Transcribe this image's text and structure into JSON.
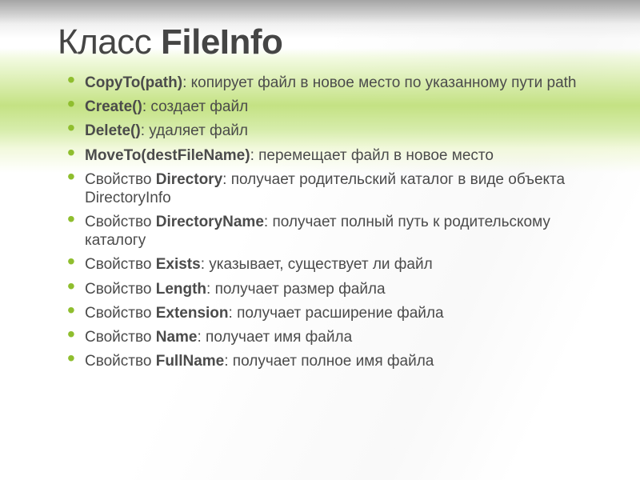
{
  "title": {
    "prefix": "Класс ",
    "name": "FileInfo"
  },
  "items": [
    {
      "method": "CopyTo(path)",
      "desc": ": копирует файл в новое место по указанному пути path"
    },
    {
      "method": "Create()",
      "desc": ": создает файл"
    },
    {
      "method": "Delete()",
      "desc": ": удаляет файл"
    },
    {
      "method": "MoveTo(destFileName)",
      "desc": ": перемещает файл в новое место"
    },
    {
      "prefix": "Свойство ",
      "method": "Directory",
      "desc": ": получает родительский каталог в виде объекта DirectoryInfo"
    },
    {
      "prefix": "Свойство ",
      "method": "DirectoryName",
      "desc": ": получает полный путь к родительскому каталогу"
    },
    {
      "prefix": "Свойство ",
      "method": "Exists",
      "desc": ": указывает, существует ли файл"
    },
    {
      "prefix": "Свойство ",
      "method": "Length",
      "desc": ": получает размер файла"
    },
    {
      "prefix": "Свойство ",
      "method": "Extension",
      "desc": ": получает расширение файла"
    },
    {
      "prefix": "Свойство ",
      "method": "Name",
      "desc": ": получает имя файла"
    },
    {
      "prefix": "Свойство ",
      "method": "FullName",
      "desc": ": получает полное имя файла"
    }
  ]
}
